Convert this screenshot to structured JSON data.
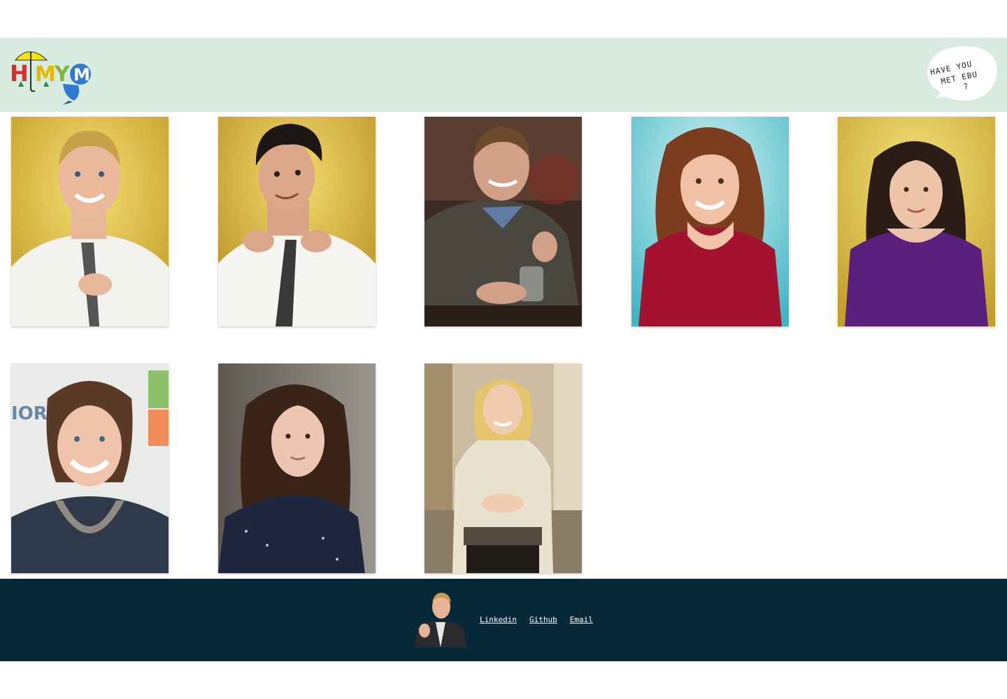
{
  "header": {
    "logo": {
      "letters": [
        "H",
        "I",
        "M",
        "Y",
        "M"
      ],
      "letter_colors": [
        "#d82e2e",
        "#2b2b2b",
        "#e6b800",
        "#e8c31a",
        "#2e7bd1"
      ],
      "umbrella_color": "#f5e600",
      "icon_name": "himym-logo"
    },
    "badge": {
      "line1": "HAVE YOU",
      "line2": "MET EBU",
      "line3": "?",
      "icon_name": "speech-bubble"
    }
  },
  "gallery": {
    "cards": [
      {
        "icon_name": "portrait-barney",
        "background": "#d8b73a"
      },
      {
        "icon_name": "portrait-ted",
        "background": "#caa62e"
      },
      {
        "icon_name": "portrait-marshall",
        "background": "#3a2a22"
      },
      {
        "icon_name": "portrait-lily",
        "background": "#5ec8d3"
      },
      {
        "icon_name": "portrait-robin",
        "background": "#d6bb3b"
      },
      {
        "icon_name": "portrait-woman-1",
        "background": "#d9dcd8"
      },
      {
        "icon_name": "portrait-woman-2",
        "background": "#7a7470"
      },
      {
        "icon_name": "portrait-woman-3",
        "background": "#b5a183"
      }
    ]
  },
  "footer": {
    "avatar_icon": "portrait-barney-thumbs-up",
    "links": {
      "linkedin": "Linkedin",
      "github": "Github",
      "email": "Email"
    }
  },
  "colors": {
    "header_bg": "#d7ebe0",
    "footer_bg": "#062838",
    "link_color": "#ffffff"
  }
}
